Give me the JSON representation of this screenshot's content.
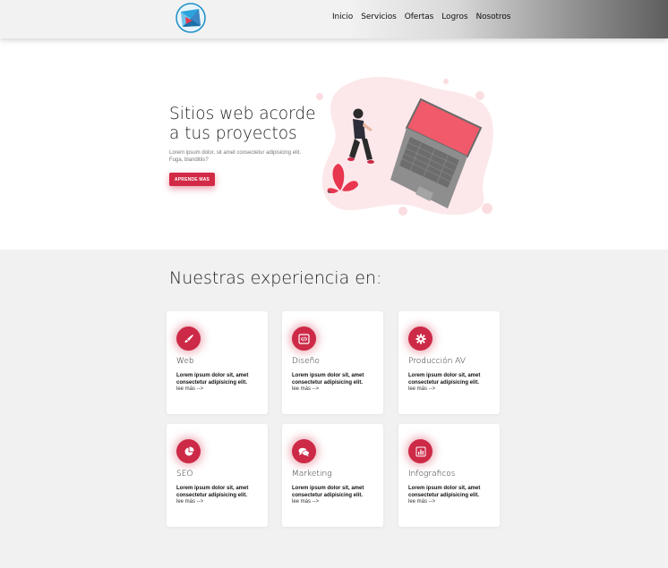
{
  "header": {
    "nav": [
      "Inicio",
      "Servicios",
      "Ofertas",
      "Logros",
      "Nosotros"
    ]
  },
  "hero": {
    "title_line1": "Sitios web acorde",
    "title_line2": "a tus proyectos",
    "text": "Lorem ipsum dolor, sit amet consectetur adipisicing elit. Fuga, blanditiis?",
    "button": "APRENDE MAS"
  },
  "section": {
    "title": "Nuestras experiencia en:"
  },
  "cards": [
    {
      "title": "Web",
      "desc": "Lorem ipsum dolor sit, amet consectetur adipisicing elit.",
      "more": "lee más -->",
      "icon": "brush-icon"
    },
    {
      "title": "Diseño",
      "desc": "Lorem ipsum dolor sit, amet consectetur adipisicing elit.",
      "more": "lee más -->",
      "icon": "code-icon"
    },
    {
      "title": "Producción AV",
      "desc": "Lorem ipsum dolor sit, amet consectetur adipisicing elit.",
      "more": "lee más -->",
      "icon": "gear-icon"
    },
    {
      "title": "SEO",
      "desc": "Lorem ipsum dolor sit, amet consectetur adipisicing elit.",
      "more": "lee más -->",
      "icon": "pie-chart-icon"
    },
    {
      "title": "Marketing",
      "desc": "Lorem ipsum dolor sit, amet consectetur adipisicing elit.",
      "more": "lee más -->",
      "icon": "chat-bubbles-icon"
    },
    {
      "title": "Infograficos",
      "desc": "Lorem ipsum dolor sit, amet consectetur adipisicing elit.",
      "more": "lee más -->",
      "icon": "bar-chart-icon"
    }
  ],
  "colors": {
    "accent": "#d22a46",
    "laptop_screen": "#f05a6a",
    "blob": "#fce8ea"
  }
}
